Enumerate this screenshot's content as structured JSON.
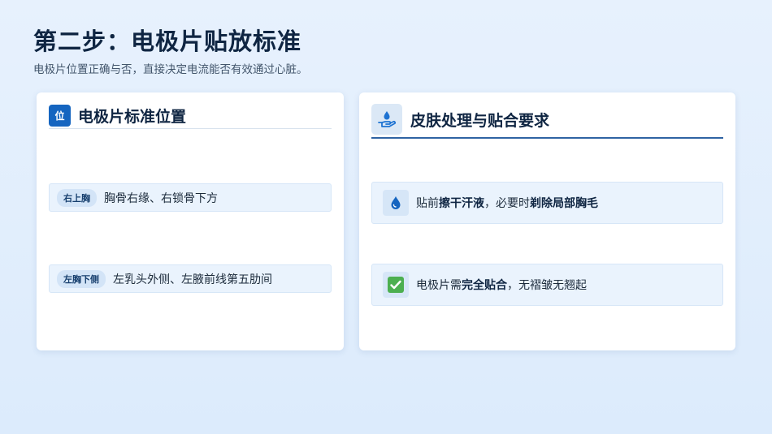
{
  "header": {
    "title": "第二步：电极片贴放标准",
    "subtitle": "电极片位置正确与否，直接决定电流能否有效通过心脏。"
  },
  "left_card": {
    "badge": "位",
    "title": "电极片标准位置",
    "positions": [
      {
        "tag": "右上胸",
        "text": "胸骨右缘、右锁骨下方"
      },
      {
        "tag": "左胸下侧",
        "text": "左乳头外侧、左腋前线第五肋间"
      }
    ]
  },
  "right_card": {
    "icon": "hand-water-icon",
    "title": "皮肤处理与贴合要求",
    "requirements": [
      {
        "icon": "water-drop-icon",
        "prefix": "贴前",
        "bold1": "擦干汗液",
        "middle": "，必要时",
        "bold2": "剃除局部胸毛",
        "suffix": ""
      },
      {
        "icon": "check-icon",
        "prefix": "电极片需",
        "bold1": "完全贴合",
        "middle": "，无褶皱无翘起",
        "bold2": "",
        "suffix": ""
      }
    ]
  },
  "colors": {
    "accent": "#1565c0",
    "divider": "#2f63a3",
    "check": "#4caf50"
  }
}
